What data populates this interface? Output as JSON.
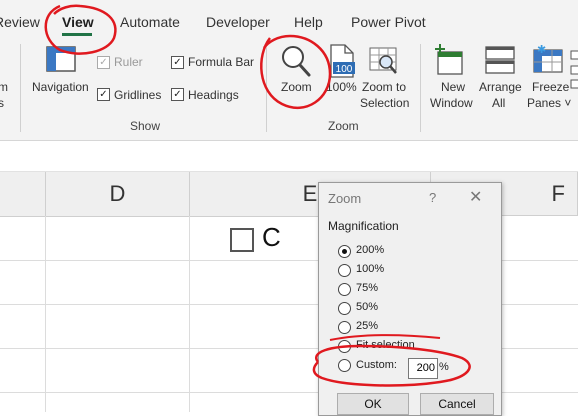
{
  "tabs": [
    "Review",
    "View",
    "Automate",
    "Developer",
    "Help",
    "Power Pivot"
  ],
  "ribbon": {
    "partial_left": [
      "m",
      "s"
    ],
    "navigation": "Navigation",
    "ruler": "Ruler",
    "formula_bar": "Formula Bar",
    "gridlines": "Gridlines",
    "headings": "Headings",
    "show_group": "Show",
    "zoom": "Zoom",
    "zoom100": "100%",
    "zoom100_badge": "100",
    "zoom_to": "Zoom to",
    "selection": "Selection",
    "zoom_group": "Zoom",
    "new": "New",
    "window": "Window",
    "arrange": "Arrange",
    "all": "All",
    "freeze": "Freeze",
    "panes": "Panes ˅",
    "checks": {
      "ruler": "✓",
      "formula_bar": "✓",
      "gridlines": "✓",
      "headings": "✓"
    }
  },
  "grid": {
    "col_d": "D",
    "col_e": "E",
    "col_f": "F",
    "cell_text": "C"
  },
  "dialog": {
    "title": "Zoom",
    "help": "?",
    "close": "✕",
    "group": "Magnification",
    "options": [
      "200%",
      "100%",
      "75%",
      "50%",
      "25%",
      "Fit selection",
      "Custom:"
    ],
    "selected": "200%",
    "custom_value": "200",
    "percent": "%",
    "ok": "OK",
    "cancel": "Cancel"
  },
  "colors": {
    "accent": "#217346",
    "annotation": "#e0191f"
  }
}
